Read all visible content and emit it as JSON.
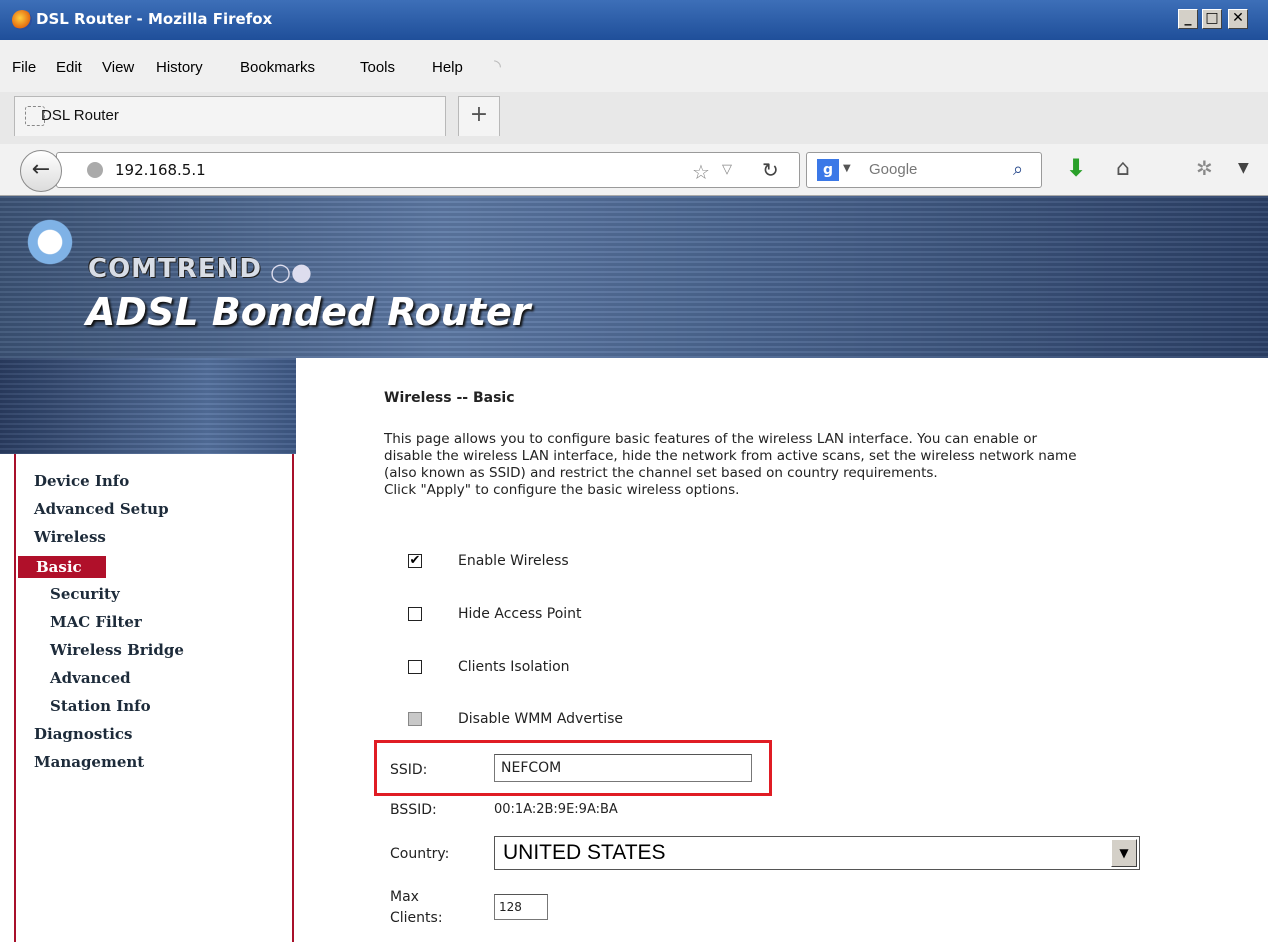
{
  "window": {
    "title": "DSL Router - Mozilla Firefox"
  },
  "menu": [
    "File",
    "Edit",
    "View",
    "History",
    "Bookmarks",
    "Tools",
    "Help"
  ],
  "tab": {
    "label": "DSL Router"
  },
  "url": "192.168.5.1",
  "search": {
    "placeholder": "Google"
  },
  "router": {
    "brand": "COMTREND",
    "product": "ADSL Bonded Router",
    "nav": {
      "device_info": "Device Info",
      "advanced_setup": "Advanced Setup",
      "wireless": "Wireless",
      "basic": "Basic",
      "security": "Security",
      "mac_filter": "MAC Filter",
      "wireless_bridge": "Wireless Bridge",
      "advanced": "Advanced",
      "station_info": "Station Info",
      "diagnostics": "Diagnostics",
      "management": "Management"
    },
    "page_title": "Wireless -- Basic",
    "description": [
      "This page allows you to configure basic features of the wireless LAN interface. You can enable or",
      "disable the wireless LAN interface, hide the network from active scans, set the wireless network name",
      "(also known as SSID) and restrict the channel set based on country requirements.",
      "Click \"Apply\" to configure the basic wireless options."
    ],
    "options": {
      "enable_wireless": {
        "label": "Enable Wireless",
        "checked": true
      },
      "hide_ap": {
        "label": "Hide Access Point",
        "checked": false
      },
      "clients_isolation": {
        "label": "Clients Isolation",
        "checked": false
      },
      "disable_wmm": {
        "label": "Disable WMM Advertise",
        "checked": false,
        "disabled": true
      }
    },
    "ssid": {
      "label": "SSID:",
      "value": "NEFCOM"
    },
    "bssid": {
      "label": "BSSID:",
      "value": "00:1A:2B:9E:9A:BA"
    },
    "country": {
      "label": "Country:",
      "value": "UNITED STATES"
    },
    "max_clients": {
      "label_line1": "Max",
      "label_line2": "Clients:",
      "value": "128"
    }
  }
}
